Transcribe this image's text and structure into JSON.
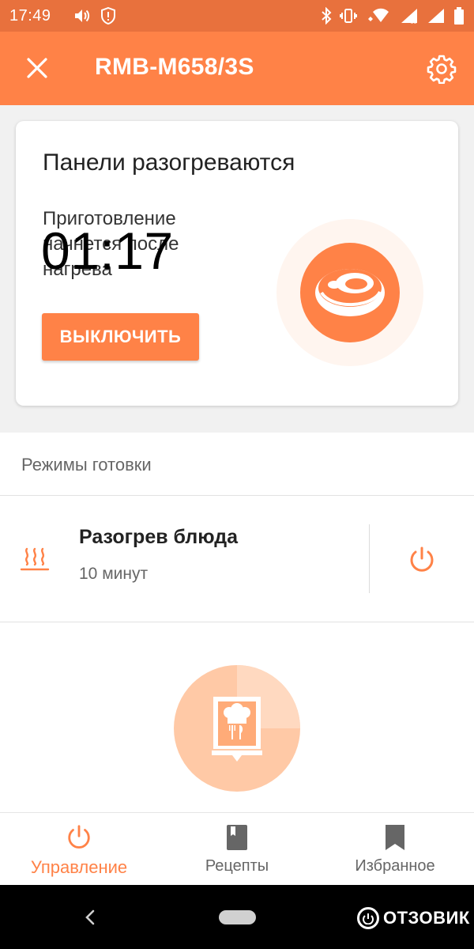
{
  "status_bar": {
    "time": "17:49",
    "icons": [
      "volume-icon",
      "alert-icon",
      "bluetooth-icon",
      "vibrate-icon",
      "wifi-icon",
      "signal-icon",
      "signal-icon",
      "battery-icon"
    ]
  },
  "app_bar": {
    "title": "RMB-M658/3S",
    "close_icon": "close-icon",
    "settings_icon": "gear-icon"
  },
  "status_card": {
    "heading": "Панели разогреваются",
    "subtext": "Приготовление начнется после нагрева",
    "timer": "01:17",
    "off_button": "ВЫКЛЮЧИТЬ",
    "mode_icon": "steak-icon"
  },
  "modes": {
    "section_title": "Режимы готовки",
    "items": [
      {
        "name": "Разогрев блюда",
        "duration": "10 минут",
        "icon": "heat-waves-icon",
        "action_icon": "power-icon"
      }
    ]
  },
  "recipe_badge_icon": "recipe-book-icon",
  "bottom_nav": {
    "items": [
      {
        "label": "Управление",
        "icon": "power-icon",
        "active": true
      },
      {
        "label": "Рецепты",
        "icon": "book-icon",
        "active": false
      },
      {
        "label": "Избранное",
        "icon": "bookmark-icon",
        "active": false
      }
    ]
  },
  "system_nav": {
    "watermark": "ОТЗОВИК"
  },
  "colors": {
    "accent": "#ff8247",
    "status_bar": "#e8713d",
    "recipe_badge": "#ffc9a6"
  }
}
